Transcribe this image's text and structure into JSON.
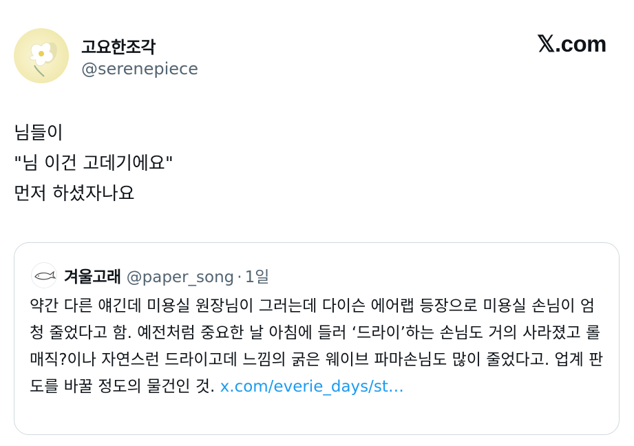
{
  "author": {
    "display_name": "고요한조각",
    "handle": "@serenepiece"
  },
  "brand": "𝕏.com",
  "tweet": {
    "text": "님들이\n\"님 이건 고데기에요\"\n먼저 하셨자나요"
  },
  "quote": {
    "display_name": "겨울고래",
    "handle": "@paper_song",
    "separator": "·",
    "time": "1일",
    "text": "약간 다른 얘긴데 미용실 원장님이 그러는데 다이슨 에어랩 등장으로 미용실 손님이 엄청 줄었다고 함. 예전처럼 중요한 날 아침에 들러 ‘드라이’하는 손님도 거의 사라졌고 롤매직?이나 자연스런 드라이고데 느낌의 굵은 웨이브 파마손님도 많이 줄었다고. 업계 판도를 바꿀 정도의 물건인 것. ",
    "link": "x.com/everie_days/st…"
  },
  "colors": {
    "text": "#0f1419",
    "secondary": "#536471",
    "link": "#1d9bf0",
    "border": "#cfd9de"
  },
  "icons": {
    "author_avatar": "white-flower-avatar",
    "quote_avatar": "whale-avatar"
  }
}
